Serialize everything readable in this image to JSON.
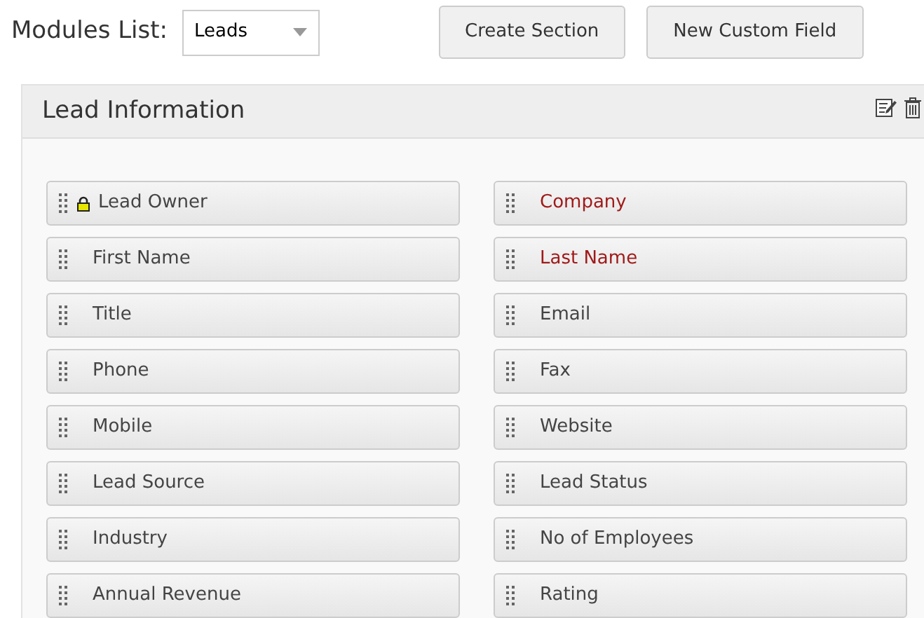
{
  "modules_list": {
    "label": "Modules List:",
    "value": "Leads"
  },
  "buttons": [
    "Create Section",
    "New Custom Field"
  ],
  "section": {
    "title": "Lead Information",
    "fields": [
      {
        "label": "Lead Owner",
        "required": false,
        "locked": true
      },
      {
        "label": "Company",
        "required": true,
        "locked": false
      },
      {
        "label": "First Name",
        "required": false,
        "locked": false
      },
      {
        "label": "Last Name",
        "required": true,
        "locked": false
      },
      {
        "label": "Title",
        "required": false,
        "locked": false
      },
      {
        "label": "Email",
        "required": false,
        "locked": false
      },
      {
        "label": "Phone",
        "required": false,
        "locked": false
      },
      {
        "label": "Fax",
        "required": false,
        "locked": false
      },
      {
        "label": "Mobile",
        "required": false,
        "locked": false
      },
      {
        "label": "Website",
        "required": false,
        "locked": false
      },
      {
        "label": "Lead Source",
        "required": false,
        "locked": false
      },
      {
        "label": "Lead Status",
        "required": false,
        "locked": false
      },
      {
        "label": "Industry",
        "required": false,
        "locked": false
      },
      {
        "label": "No of Employees",
        "required": false,
        "locked": false
      },
      {
        "label": "Annual Revenue",
        "required": false,
        "locked": false
      },
      {
        "label": "Rating",
        "required": false,
        "locked": false
      }
    ]
  }
}
